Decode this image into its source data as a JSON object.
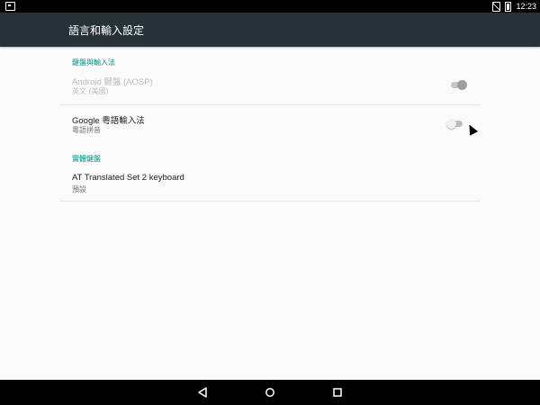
{
  "status_bar": {
    "time": "12:23"
  },
  "app_bar": {
    "title": "語言和輸入設定"
  },
  "sections": [
    {
      "header": "鍵盤與輸入法",
      "items": [
        {
          "title": "Android 鍵盤 (AOSP)",
          "summary": "英文 (美國)",
          "enabled": false,
          "toggle": "on"
        },
        {
          "title": "Google 粵語輸入法",
          "summary": "粵語拼音",
          "enabled": true,
          "toggle": "off"
        }
      ]
    },
    {
      "header": "實體鍵盤",
      "items": [
        {
          "title": "AT Translated Set 2 keyboard",
          "summary": "預設"
        }
      ]
    }
  ],
  "colors": {
    "app_bar": "#263238",
    "accent": "#009688",
    "background": "#fafafa"
  },
  "icons": {
    "nav": [
      "back-icon",
      "home-icon",
      "recents-icon"
    ]
  }
}
